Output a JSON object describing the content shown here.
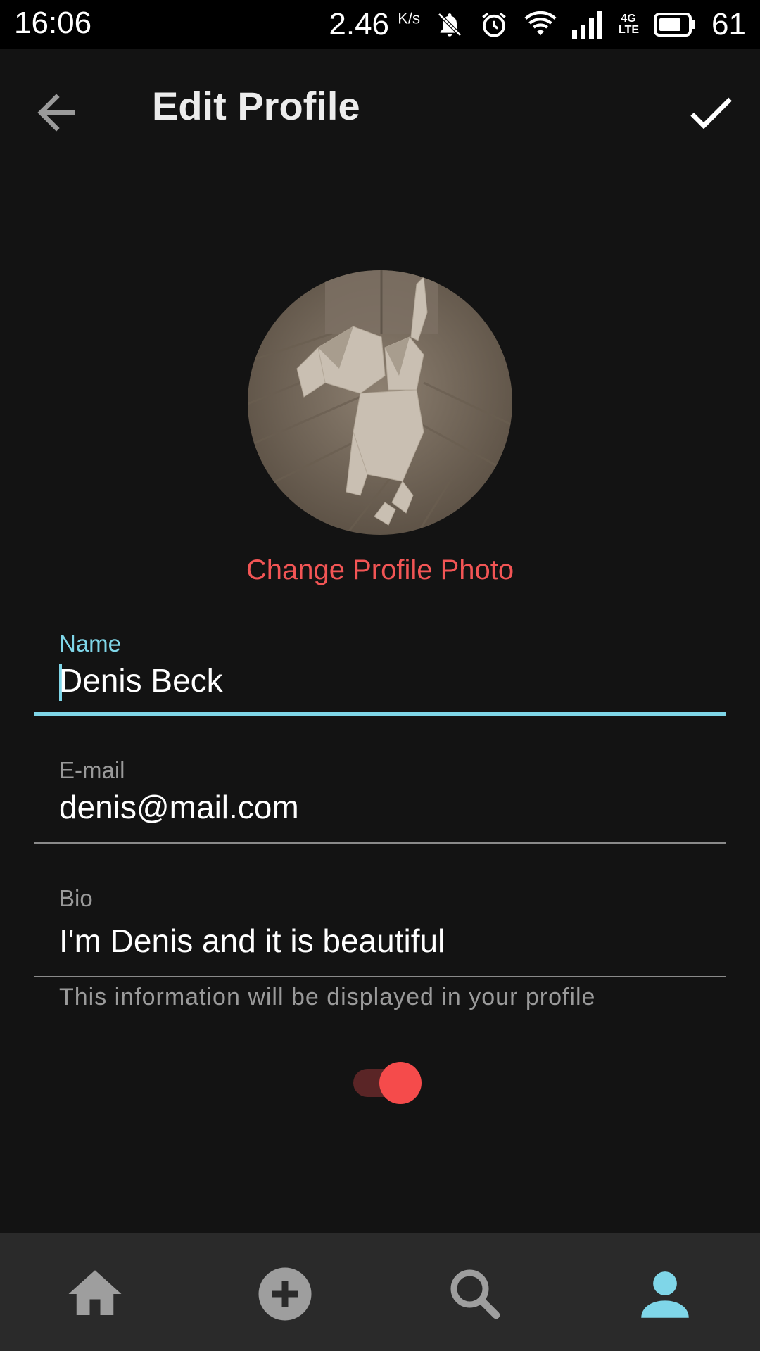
{
  "status_bar": {
    "time": "16:06",
    "speed": "2.46",
    "speed_unit": "K/s",
    "battery": "61",
    "network": "4G LTE"
  },
  "app_bar": {
    "title": "Edit Profile",
    "back_icon": "arrow-back-icon",
    "save_icon": "check-icon"
  },
  "profile": {
    "change_photo_label": "Change Profile Photo"
  },
  "form": {
    "name": {
      "label": "Name",
      "value": "Denis Beck"
    },
    "email": {
      "label": "E-mail",
      "value": "denis@mail.com"
    },
    "bio": {
      "label": "Bio",
      "value": "I'm Denis and it is beautiful",
      "helper": "This information will be displayed in your profile"
    },
    "toggle_on": true
  },
  "bottom_nav": {
    "items": [
      {
        "icon": "home-icon",
        "active": false
      },
      {
        "icon": "add-circle-icon",
        "active": false
      },
      {
        "icon": "search-icon",
        "active": false
      },
      {
        "icon": "person-icon",
        "active": true
      }
    ]
  },
  "colors": {
    "accent": "#7fd6e8",
    "danger": "#f25555",
    "background": "#131313",
    "nav_background": "#2a2a2a",
    "inactive_icon": "#9e9e9e"
  }
}
